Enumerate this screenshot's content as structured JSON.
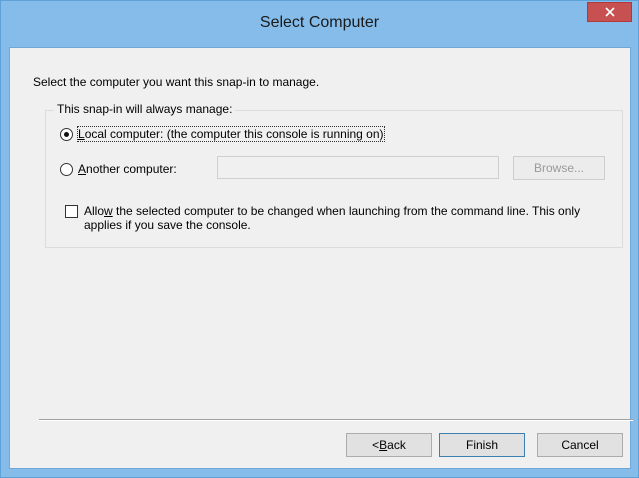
{
  "window": {
    "title": "Select Computer",
    "close_icon": "close-icon",
    "accent_color": "#86bcea",
    "close_color": "#c75050"
  },
  "content": {
    "intro": "Select the computer you want this snap-in to manage."
  },
  "group": {
    "legend": "This snap-in will always manage:",
    "local_option": {
      "label_mnemonic": "L",
      "label_rest": "ocal computer:  (the computer this console is running on)",
      "selected": true
    },
    "another_option": {
      "label_mnemonic": "A",
      "label_rest": "nother computer:",
      "selected": false
    },
    "computer_name": {
      "value": "",
      "placeholder": ""
    },
    "browse_label": "Browse...",
    "allow_change": {
      "label_pre": "Allo",
      "label_mnemonic": "w",
      "label_post": " the selected computer to be changed when launching from the command line.  This only applies if you save the console.",
      "checked": false
    }
  },
  "footer": {
    "back_label_pre": "< ",
    "back_mnemonic": "B",
    "back_label_post": "ack",
    "finish_label": "Finish",
    "cancel_label": "Cancel"
  }
}
